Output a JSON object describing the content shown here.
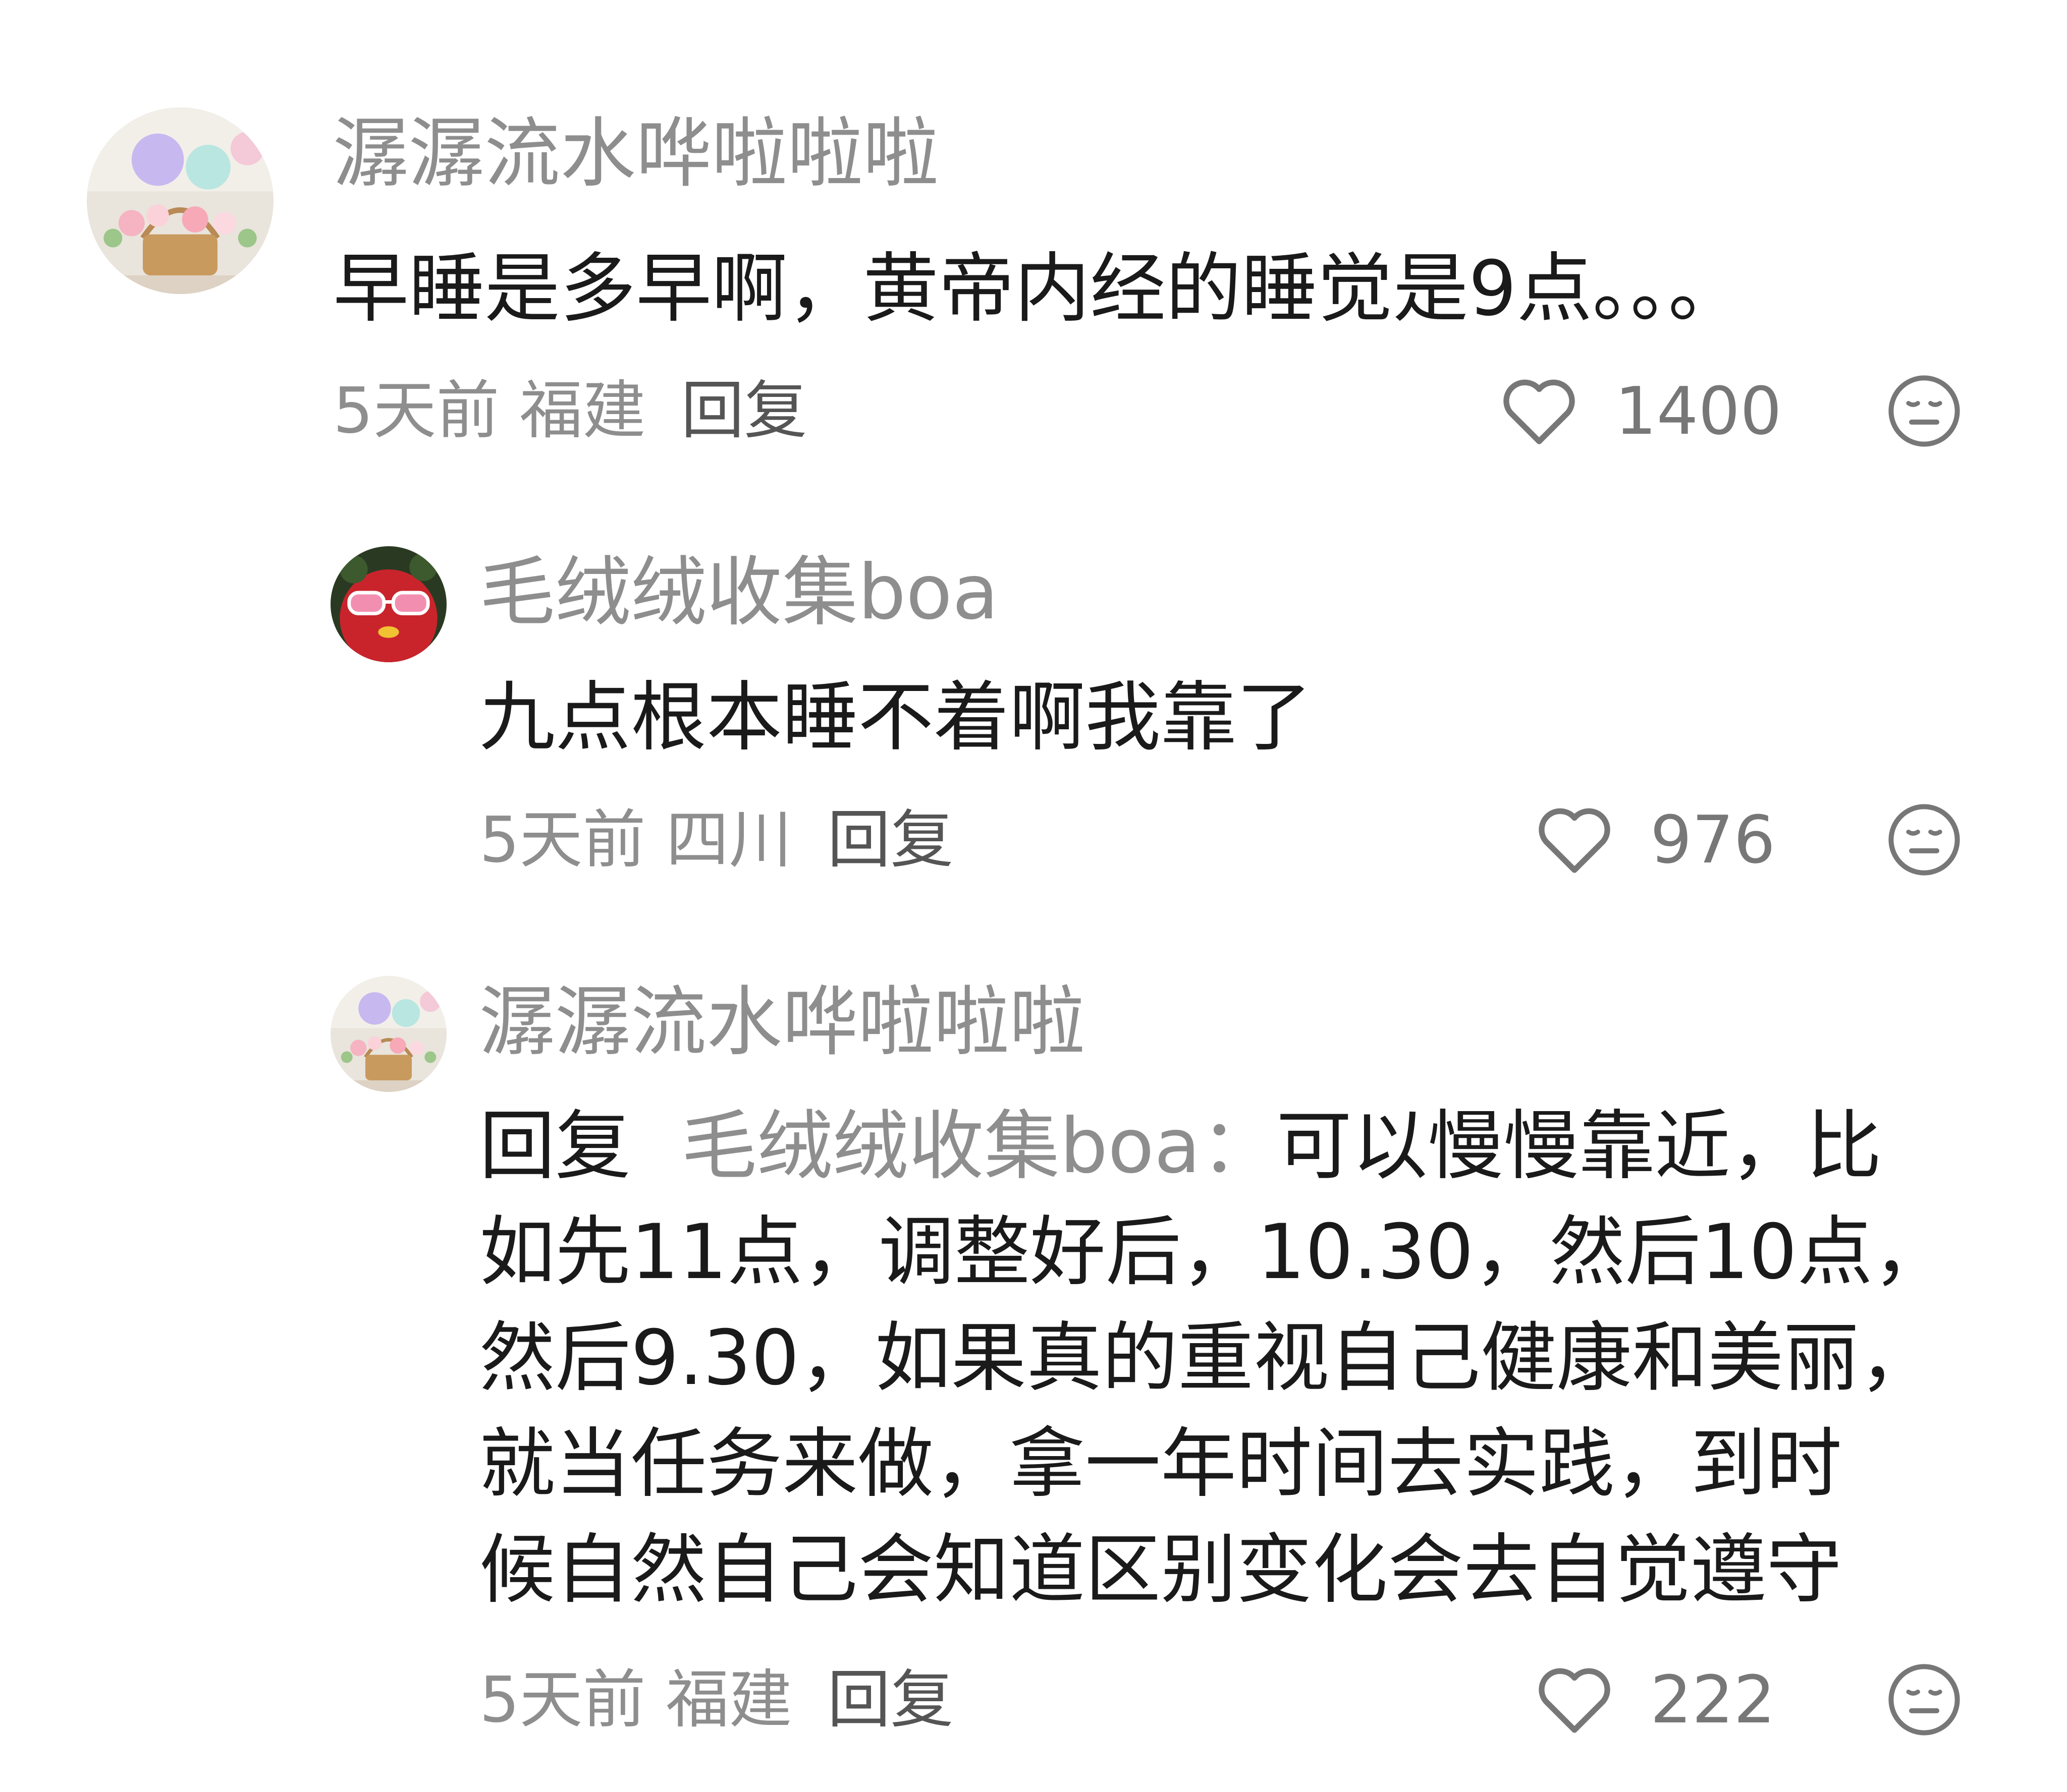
{
  "comments": [
    {
      "avatar": "flower-basket-balloons-avatar",
      "username": "潺潺流水哗啦啦啦",
      "text": "早睡是多早啊，黄帝内经的睡觉是9点。。。",
      "time": "5天前",
      "region": "福建",
      "reply_label": "回复",
      "likes": "1400",
      "like_icon": "heart-outline-icon",
      "dislike_icon": "expressionless-face-icon"
    },
    {
      "avatar": "red-mascot-sunglasses-avatar",
      "username": "毛绒绒收集boa",
      "text": "九点根本睡不着啊我靠了",
      "time": "5天前",
      "region": "四川",
      "reply_label": "回复",
      "likes": "976",
      "like_icon": "heart-outline-icon",
      "dislike_icon": "expressionless-face-icon"
    },
    {
      "avatar": "flower-basket-balloons-avatar",
      "username": "潺潺流水哗啦啦啦",
      "reply_prefix": "回复",
      "reply_target": "毛绒绒收集boa：",
      "text_lines": [
        "可以慢慢靠近，比",
        "如先11点，调整好后，10.30，然后10点，",
        "然后9.30，如果真的重视自己健康和美丽，",
        "就当任务来做，拿一年时间去实践，到时",
        "候自然自己会知道区别变化会去自觉遵守"
      ],
      "time": "5天前",
      "region": "福建",
      "reply_label": "回复",
      "likes": "222",
      "like_icon": "heart-outline-icon",
      "dislike_icon": "expressionless-face-icon"
    }
  ]
}
